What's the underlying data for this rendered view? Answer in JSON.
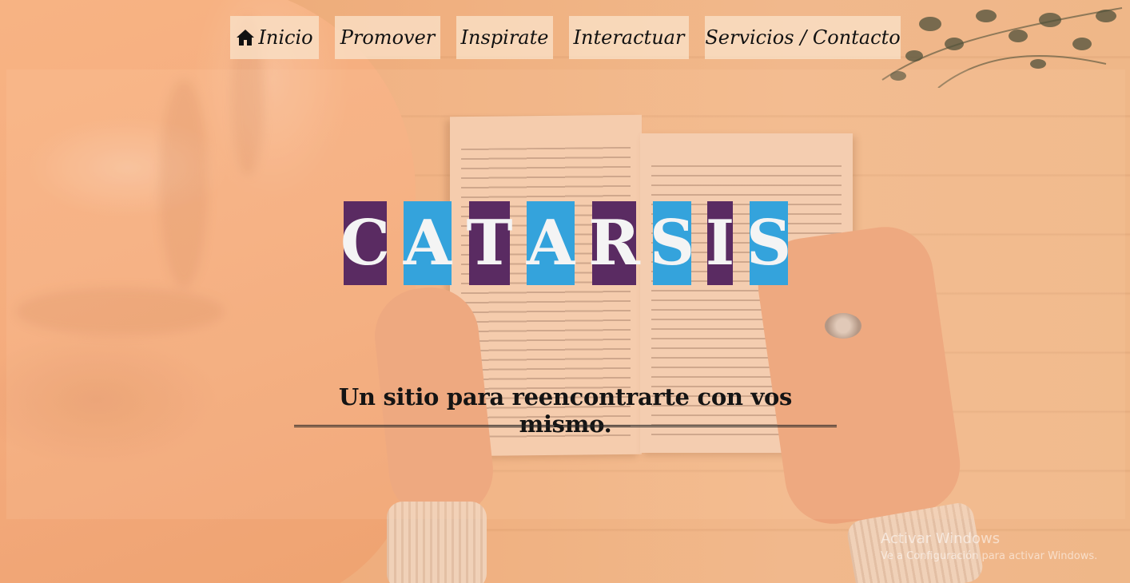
{
  "nav": {
    "items": [
      {
        "label": "Inicio",
        "icon": "home-icon"
      },
      {
        "label": "Promover"
      },
      {
        "label": "Inspirate"
      },
      {
        "label": "Interactuar"
      },
      {
        "label": "Servicios / Contacto"
      }
    ]
  },
  "logo": {
    "letters": [
      "C",
      "A",
      "T",
      "A",
      "R",
      "S",
      "I",
      "S"
    ],
    "colors": {
      "purple": "#5a2b62",
      "blue": "#34a3dc"
    },
    "pattern": [
      "purple",
      "blue",
      "purple",
      "blue",
      "purple",
      "blue",
      "purple",
      "blue"
    ]
  },
  "tagline": "Un sitio para reencontrarte con vos mismo.",
  "watermark": {
    "title": "Activar Windows",
    "subtitle": "Ve a Configuración para activar Windows."
  },
  "colors": {
    "background": "#f0b483",
    "nav_bg": "#fae1c8"
  }
}
